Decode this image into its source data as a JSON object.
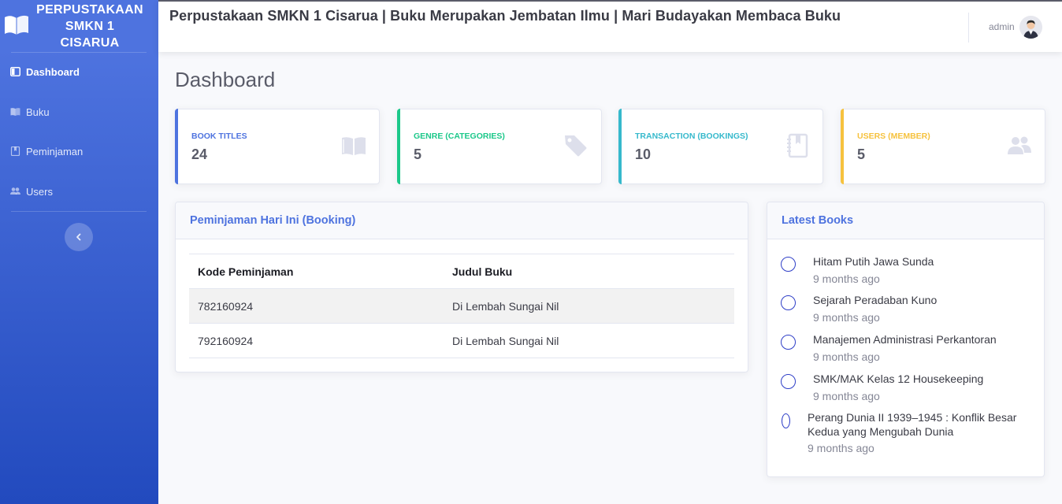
{
  "brand": {
    "name": "PERPUSTAKAAN SMKN 1 CISARUA"
  },
  "sidebar": {
    "items": [
      {
        "label": "Dashboard",
        "icon": "dashboard-icon",
        "active": true
      },
      {
        "label": "Buku",
        "icon": "book-icon",
        "active": false
      },
      {
        "label": "Peminjaman",
        "icon": "bookmark-icon",
        "active": false
      },
      {
        "label": "Users",
        "icon": "users-icon",
        "active": false
      }
    ],
    "toggle_icon": "chevron-left-icon"
  },
  "topbar": {
    "title": "Perpustakaan SMKN 1 Cisarua | Buku Merupakan Jembatan Ilmu | Mari Budayakan Membaca Buku",
    "username": "admin"
  },
  "page": {
    "title": "Dashboard"
  },
  "stats": [
    {
      "label": "BOOK TITLES",
      "value": "24",
      "color": "#4e73df",
      "icon": "book-open-icon"
    },
    {
      "label": "GENRE (CATEGORIES)",
      "value": "5",
      "color": "#1cc88a",
      "icon": "tag-icon"
    },
    {
      "label": "TRANSACTION (BOOKINGS)",
      "value": "10",
      "color": "#36b9cc",
      "icon": "notebook-icon"
    },
    {
      "label": "USERS (MEMBER)",
      "value": "5",
      "color": "#f6c23e",
      "icon": "users-icon"
    }
  ],
  "booking": {
    "title": "Peminjaman Hari Ini (Booking)",
    "columns": [
      "Kode Peminjaman",
      "Judul Buku"
    ],
    "rows": [
      [
        "782160924",
        "Di Lembah Sungai Nil"
      ],
      [
        "792160924",
        "Di Lembah Sungai Nil"
      ]
    ]
  },
  "latest": {
    "title": "Latest Books",
    "items": [
      {
        "title": "Hitam Putih Jawa Sunda",
        "time": "9 months ago"
      },
      {
        "title": "Sejarah Peradaban Kuno",
        "time": "9 months ago"
      },
      {
        "title": "Manajemen Administrasi Perkantoran",
        "time": "9 months ago"
      },
      {
        "title": "SMK/MAK Kelas 12 Housekeeping",
        "time": "9 months ago"
      },
      {
        "title": "Perang Dunia II 1939–1945 : Konflik Besar Kedua yang Mengubah Dunia",
        "time": "9 months ago"
      }
    ]
  }
}
